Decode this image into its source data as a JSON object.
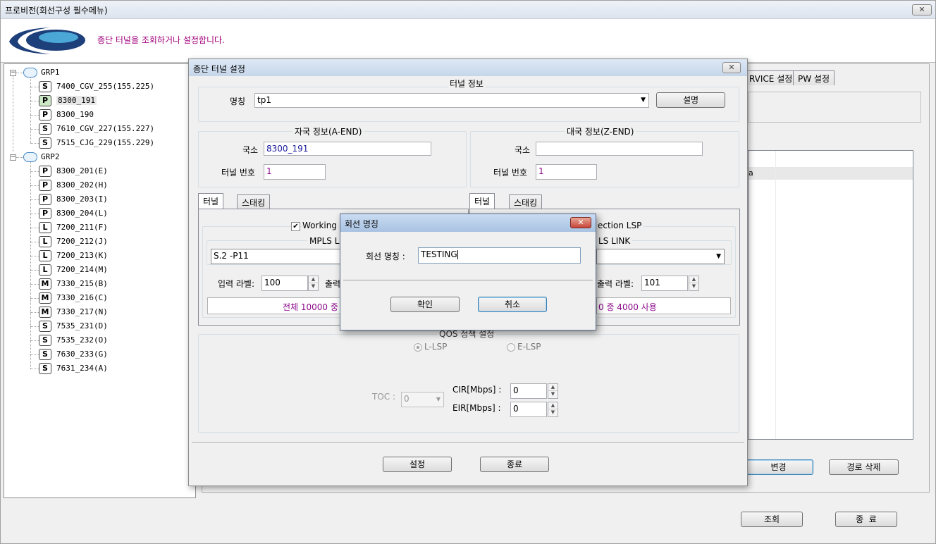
{
  "main_window": {
    "title": "프로비전(회선구성 필수메뉴)",
    "banner_text": "종단 터널을 조회하거나 설정합니다.",
    "close_glyph": "✕"
  },
  "tree": {
    "groups": [
      {
        "label": "GRP1",
        "nodes": [
          {
            "type": "S",
            "label": "7400_CGV_255(155.225)"
          },
          {
            "type": "P",
            "label": "8300_191"
          },
          {
            "type": "P",
            "label": "8300_190"
          },
          {
            "type": "S",
            "label": "7610_CGV_227(155.227)"
          },
          {
            "type": "S",
            "label": "7515_CJG_229(155.229)"
          }
        ]
      },
      {
        "label": "GRP2",
        "nodes": [
          {
            "type": "P",
            "label": "8300_201(E)"
          },
          {
            "type": "P",
            "label": "8300_202(H)"
          },
          {
            "type": "P",
            "label": "8300_203(I)"
          },
          {
            "type": "P",
            "label": "8300_204(L)"
          },
          {
            "type": "L",
            "label": "7200_211(F)"
          },
          {
            "type": "L",
            "label": "7200_212(J)"
          },
          {
            "type": "L",
            "label": "7200_213(K)"
          },
          {
            "type": "L",
            "label": "7200_214(M)"
          },
          {
            "type": "M",
            "label": "7330_215(B)"
          },
          {
            "type": "M",
            "label": "7330_216(C)"
          },
          {
            "type": "M",
            "label": "7330_217(N)"
          },
          {
            "type": "S",
            "label": "7535_231(D)"
          },
          {
            "type": "S",
            "label": "7535_232(O)"
          },
          {
            "type": "S",
            "label": "7630_233(G)"
          },
          {
            "type": "S",
            "label": "7631_234(A)"
          }
        ]
      }
    ]
  },
  "background_panel": {
    "tabs": [
      "RVICE 설정",
      "PW 설정"
    ],
    "list_fragment": "a",
    "change_button": "변경",
    "delete_path_button": "경로 삭제",
    "query_button": "조회",
    "exit_button": "종  료"
  },
  "tunnel_dialog": {
    "title": "종단 터널 설정",
    "tunnel_info": {
      "legend": "터널 정보",
      "name_label": "명칭",
      "name_value": "tp1",
      "describe_button": "설명"
    },
    "a_end": {
      "legend": "자국 정보(A-END)",
      "office_label": "국소",
      "office_value": "8300_191",
      "tunnel_no_label": "터널 번호",
      "tunnel_no_value": "1"
    },
    "z_end": {
      "legend": "대국 정보(Z-END)",
      "office_label": "국소",
      "office_value": "",
      "tunnel_no_label": "터널 번호",
      "tunnel_no_value": "1"
    },
    "left_tabs": [
      "터널",
      "스태킹"
    ],
    "right_tabs": [
      "터널",
      "스태킹"
    ],
    "working": {
      "checkbox_label": "Working",
      "mpls_legend": "MPLS L",
      "link_value": "S.2 -P11",
      "in_label_text": "입력 라벨:",
      "in_label_value": "100",
      "out_label_text": "출력",
      "usage_text": "전체 10000 중"
    },
    "protection": {
      "legend": "ection LSP",
      "mpls_legend": "LS LINK",
      "out_label_text": "출력 라벨:",
      "out_label_value": "101",
      "usage_text": "0 중 4000 사용"
    },
    "qos": {
      "legend": "QOS 정책 설정",
      "l_lsp": "L-LSP",
      "e_lsp": "E-LSP",
      "toc_label": "TOC :",
      "toc_value": "0",
      "cir_label": "CIR[Mbps] :",
      "cir_value": "0",
      "eir_label": "EIR[Mbps] :",
      "eir_value": "0"
    },
    "set_button": "설정",
    "close_button": "종료"
  },
  "circuit_name_dialog": {
    "title": "회선 명칭",
    "field_label": "회선 명칭 :",
    "field_value": "TESTING",
    "ok_button": "확인",
    "cancel_button": "취소"
  },
  "colors": {
    "banner_text": "#a0007c",
    "usage_text": "#8b0a8b",
    "value_text": "#1a1a9c",
    "close_red": "#c7463a"
  }
}
